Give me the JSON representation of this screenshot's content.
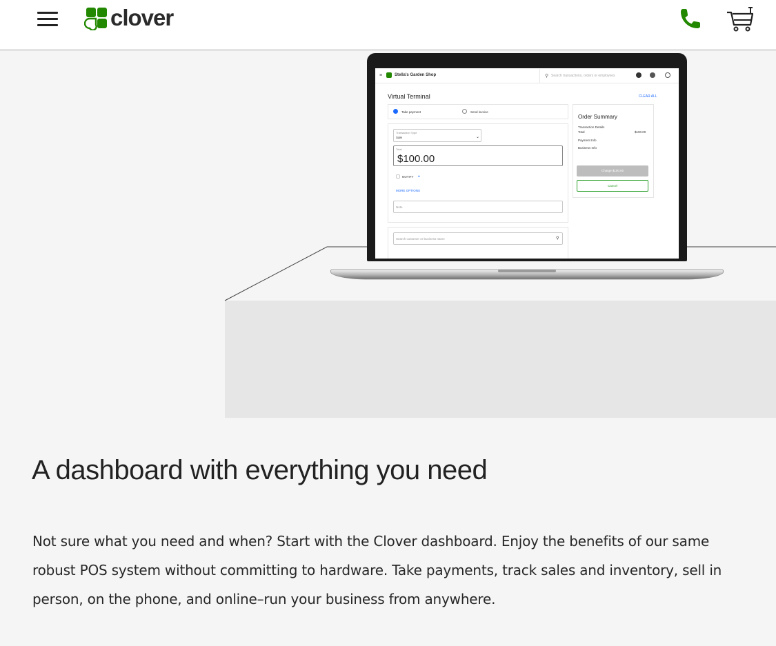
{
  "header": {
    "logo_text": "clover"
  },
  "icons": {
    "menu": "hamburger-menu-icon",
    "logo": "clover-leaf-icon",
    "phone": "phone-icon",
    "cart": "shopping-cart-icon"
  },
  "colors": {
    "brand_green": "#228800",
    "header_bg": "#ffffff",
    "page_bg": "#f5f5f5",
    "accent_blue": "#1b6aff",
    "cancel_green": "#2ca02c"
  },
  "laptop_ui": {
    "shop_name": "Stella's Garden Shop",
    "search_placeholder": "Search transactions, orders or employees",
    "page_title": "Virtual Terminal",
    "clear_all": "CLEAR ALL",
    "tab_take_payment": "Take payment",
    "tab_send_invoice": "Send invoice",
    "transaction_type_label": "Transaction Type",
    "transaction_type_value": "Sale",
    "total_label": "Total",
    "amount": "$100.00",
    "notify_label": "NOTIFY",
    "more_options": "MORE OPTIONS",
    "note_placeholder": "Note",
    "customer_search_placeholder": "Search customer or business name",
    "order_summary_title": "Order Summary",
    "transaction_details": "Transaction Details",
    "total": "Total",
    "total_value": "$100.00",
    "payment_info": "Payment Info",
    "business_info": "Business Info",
    "charge_button": "Charge $100.00",
    "cancel_button": "Cancel"
  },
  "main": {
    "headline": "A dashboard with everything you need",
    "body": "Not sure what you need and when? Start with the Clover dashboard. Enjoy the benefits of our same robust POS system without committing to hardware. Take payments, track sales and inventory, sell in person, on the phone, and online–run your business from anywhere."
  }
}
